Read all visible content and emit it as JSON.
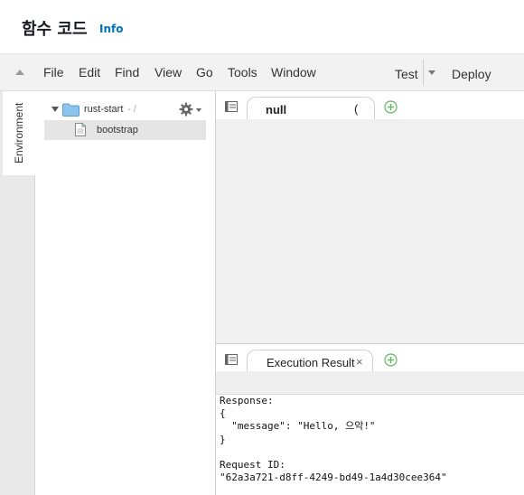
{
  "header": {
    "title": "함수 코드",
    "info_link": "Info"
  },
  "menubar": {
    "items": [
      "File",
      "Edit",
      "Find",
      "View",
      "Go",
      "Tools",
      "Window"
    ],
    "test_label": "Test",
    "deploy_label": "Deploy"
  },
  "sidebar": {
    "environment_label": "Environment"
  },
  "tree": {
    "folder": {
      "name": "rust-start",
      "path": "- /"
    },
    "files": [
      {
        "name": "bootstrap"
      }
    ]
  },
  "editor": {
    "tab_label": "null",
    "tab_spinner": "("
  },
  "results": {
    "tab_label": "Execution Result",
    "close_glyph": "×",
    "lines": [
      "Response:",
      "{",
      "  \"message\": \"Hello, 으악!\"",
      "}",
      "",
      "Request ID:",
      "\"62a3a721-d8ff-4249-bd49-1a4d30cee364\""
    ]
  },
  "icons": {
    "collapse": "caret-up-icon",
    "folder": "folder-icon",
    "settings": "gear-icon",
    "file": "file-icon",
    "tab_menu": "tab-menu-icon",
    "add_tab": "add-tab-icon"
  },
  "colors": {
    "info_link": "#0073bb",
    "folder": "#7ab8e6",
    "add_icon": "#5cb85c"
  }
}
